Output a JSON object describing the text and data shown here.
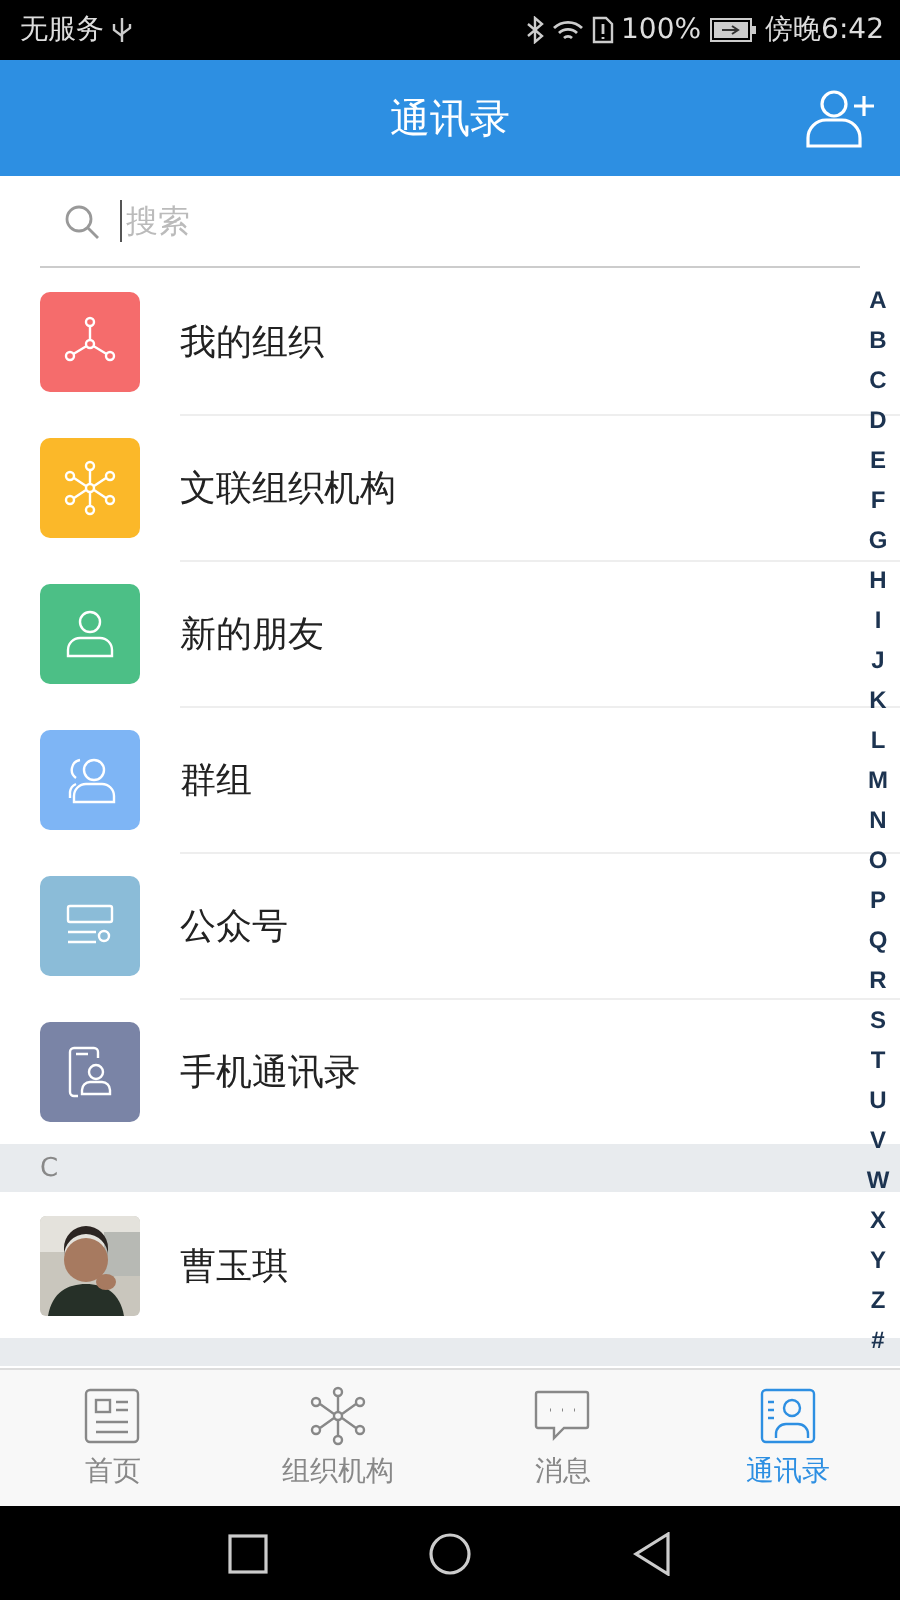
{
  "status_bar": {
    "carrier": "无服务",
    "battery": "100%",
    "time": "傍晚6:42"
  },
  "header": {
    "title": "通讯录"
  },
  "search": {
    "placeholder": "搜索"
  },
  "menu": [
    {
      "kind": "org",
      "label": "我的组织",
      "color": "#f56c6c"
    },
    {
      "kind": "network",
      "label": "文联组织机构",
      "color": "#fbb829"
    },
    {
      "kind": "friend",
      "label": "新的朋友",
      "color": "#4cbf86"
    },
    {
      "kind": "group",
      "label": "群组",
      "color": "#7eb5f5"
    },
    {
      "kind": "official",
      "label": "公众号",
      "color": "#8bbcd8"
    },
    {
      "kind": "phone",
      "label": "手机通讯录",
      "color": "#7a84a6"
    }
  ],
  "sections": [
    {
      "letter": "C",
      "contacts": [
        {
          "name": "曹玉琪"
        }
      ]
    }
  ],
  "index": [
    "A",
    "B",
    "C",
    "D",
    "E",
    "F",
    "G",
    "H",
    "I",
    "J",
    "K",
    "L",
    "M",
    "N",
    "O",
    "P",
    "Q",
    "R",
    "S",
    "T",
    "U",
    "V",
    "W",
    "X",
    "Y",
    "Z",
    "#"
  ],
  "tabs": [
    {
      "kind": "home",
      "label": "首页",
      "selected": false
    },
    {
      "kind": "network",
      "label": "组织机构",
      "selected": false
    },
    {
      "kind": "message",
      "label": "消息",
      "selected": false
    },
    {
      "kind": "contacts",
      "label": "通讯录",
      "selected": true
    }
  ]
}
